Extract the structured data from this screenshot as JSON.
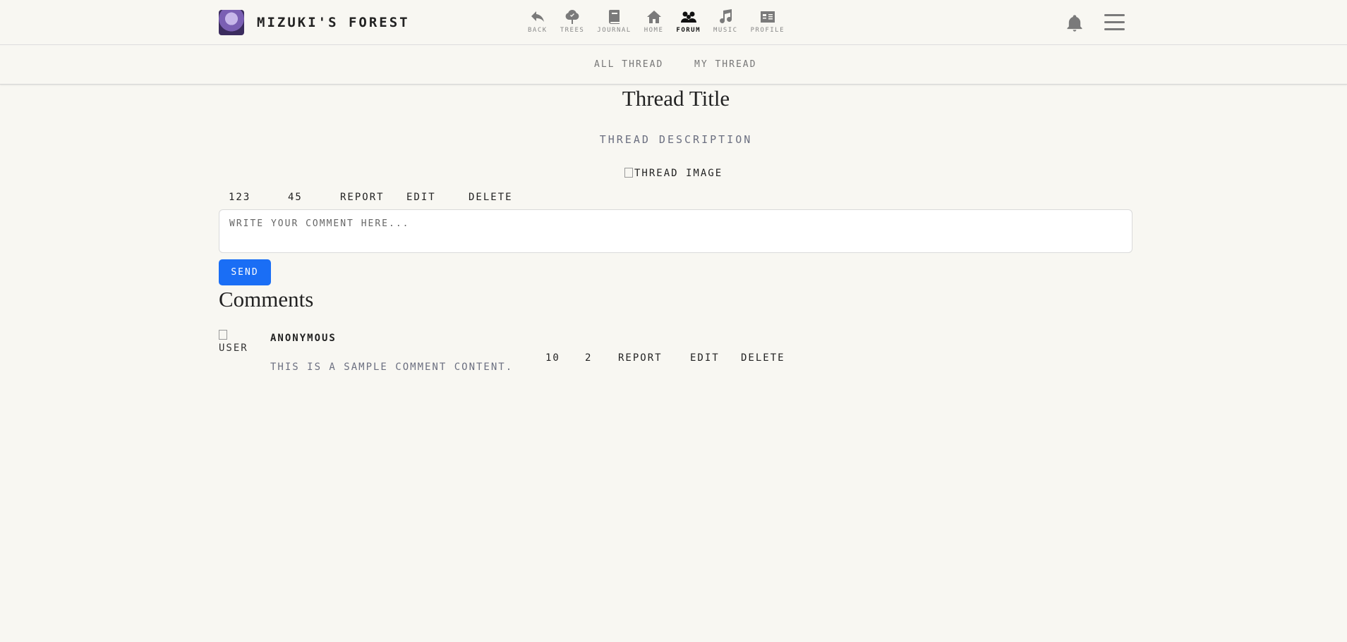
{
  "header": {
    "brand": "Mizuki's Forest",
    "nav": [
      {
        "label": "Back",
        "icon": "back-arrow-icon",
        "active": false
      },
      {
        "label": "Trees",
        "icon": "tree-icon",
        "active": false
      },
      {
        "label": "Journal",
        "icon": "book-icon",
        "active": false
      },
      {
        "label": "Home",
        "icon": "home-icon",
        "active": false
      },
      {
        "label": "Forum",
        "icon": "people-icon",
        "active": true
      },
      {
        "label": "Music",
        "icon": "music-note-icon",
        "active": false
      },
      {
        "label": "Profile",
        "icon": "id-card-icon",
        "active": false
      }
    ]
  },
  "subnav": {
    "all_thread": "All Thread",
    "my_thread": "My Thread"
  },
  "thread": {
    "title": "Thread Title",
    "description": "Thread Description",
    "image_alt": "Thread Image",
    "likes": "123",
    "dislikes": "45",
    "report": "Report",
    "edit": "Edit",
    "delete": "Delete"
  },
  "comment_form": {
    "placeholder": "Write your comment here...",
    "send_label": "Send"
  },
  "comments": {
    "heading": "Comments",
    "items": [
      {
        "avatar_alt": "User",
        "author": "Anonymous",
        "text": "This is a sample comment content.",
        "likes": "10",
        "dislikes": "2",
        "report": "Report",
        "edit": "Edit",
        "delete": "Delete"
      }
    ]
  },
  "colors": {
    "background": "#f8f7f2",
    "accent": "#1a6ef5",
    "muted_text": "#6b6f80"
  }
}
